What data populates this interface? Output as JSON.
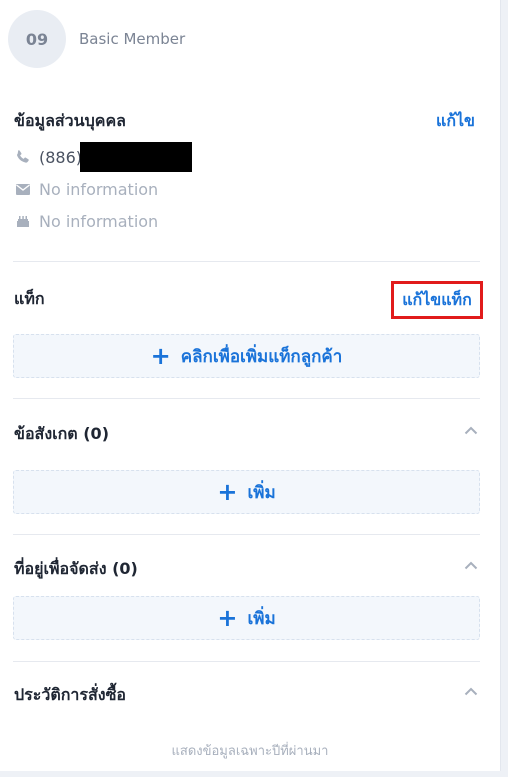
{
  "member": {
    "number": "09",
    "tier": "Basic Member"
  },
  "personal_info": {
    "title": "ข้อมูลส่วนบุคคล",
    "edit_label": "แก้ไข",
    "phone": "(886)",
    "email": "No information",
    "birthday": "No information"
  },
  "tags": {
    "title": "แท็ก",
    "edit_label": "แก้ไขแท็ก",
    "add_label": "คลิกเพื่อเพิ่มแท็กลูกค้า"
  },
  "notes": {
    "title": "ข้อสังเกต (0)",
    "add_label": "เพิ่ม"
  },
  "addresses": {
    "title": "ที่อยู่เพื่อจัดส่ง (0)",
    "add_label": "เพิ่ม"
  },
  "orders": {
    "title": "ประวัติการสั่งซื้อ"
  },
  "footer": {
    "note": "แสดงข้อมูลเฉพาะปีที่ผ่านมา"
  },
  "icons": {
    "phone": "phone-icon",
    "email": "envelope-icon",
    "birthday": "cake-icon",
    "plus": "plus-icon",
    "collapse": "chevron-up-icon"
  },
  "colors": {
    "accent": "#1a73d9",
    "highlight_border": "#e11b1b",
    "muted": "#a8b0bd"
  }
}
